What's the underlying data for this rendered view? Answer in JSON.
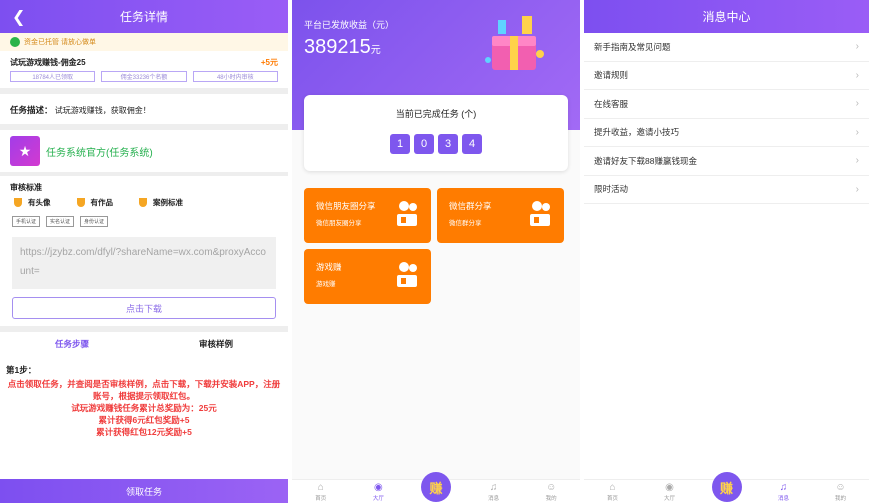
{
  "task_detail": {
    "title": "任务详情",
    "notice": "资金已托管 请放心做单",
    "task_name": "试玩游戏赚钱-佣金25",
    "reward": "+5元",
    "stats": [
      "18784人已领取",
      "佣金33236个名额",
      "48小时内审核"
    ],
    "desc_label": "任务描述：",
    "desc_text": "试玩游戏赚钱，获取佣金！",
    "system_name": "任务系统官方(任务系统)",
    "audit_title": "审核标准",
    "audit_items": [
      "有头像",
      "有作品",
      "案例标准"
    ],
    "tags": [
      "手机认证",
      "实名认证",
      "身份认证"
    ],
    "url": "https://jzybz.com/dfyl/?shareName=wx.com&proxyAccount=",
    "download_btn": "点击下载",
    "tab_steps": "任务步骤",
    "tab_sample": "审核样例",
    "step_title": "第1步：",
    "step_lines": [
      "点击领取任务，并查阅是否审核样例，点击下载，下载并安装APP，注册账号，根据提示领取红包。",
      "试玩游戏赚钱任务累计总奖励为：25元",
      "累计获得6元红包奖励+5",
      "累计获得红包12元奖励+5"
    ],
    "get_btn": "领取任务"
  },
  "hall": {
    "earn_label": "平台已发放收益（元）",
    "earn_amount": "389215",
    "earn_unit": "元",
    "done_label": "当前已完成任务 (个)",
    "digits": [
      "1",
      "0",
      "3",
      "4"
    ],
    "tiles": [
      {
        "title": "微信朋友圈分享",
        "sub": "微信朋友圈分享"
      },
      {
        "title": "微信群分享",
        "sub": "微信群分享"
      },
      {
        "title": "游戏赚",
        "sub": "游戏赚"
      }
    ],
    "tabbar": {
      "home": "首页",
      "hall": "大厅",
      "earn": "赚",
      "msg": "消息",
      "mine": "我的"
    }
  },
  "messages": {
    "title": "消息中心",
    "items": [
      "新手指南及常见问题",
      "邀请规则",
      "在线客服",
      "提升收益，邀请小技巧",
      "邀请好友下载88赚赢钱现金",
      "限时活动"
    ],
    "tabbar": {
      "home": "首页",
      "hall": "大厅",
      "earn": "赚",
      "msg": "消息",
      "mine": "我的"
    }
  },
  "colors": {
    "purple": "#7e57ee",
    "orange": "#ff7c00",
    "red": "#f03c3c",
    "green": "#25b04e"
  }
}
